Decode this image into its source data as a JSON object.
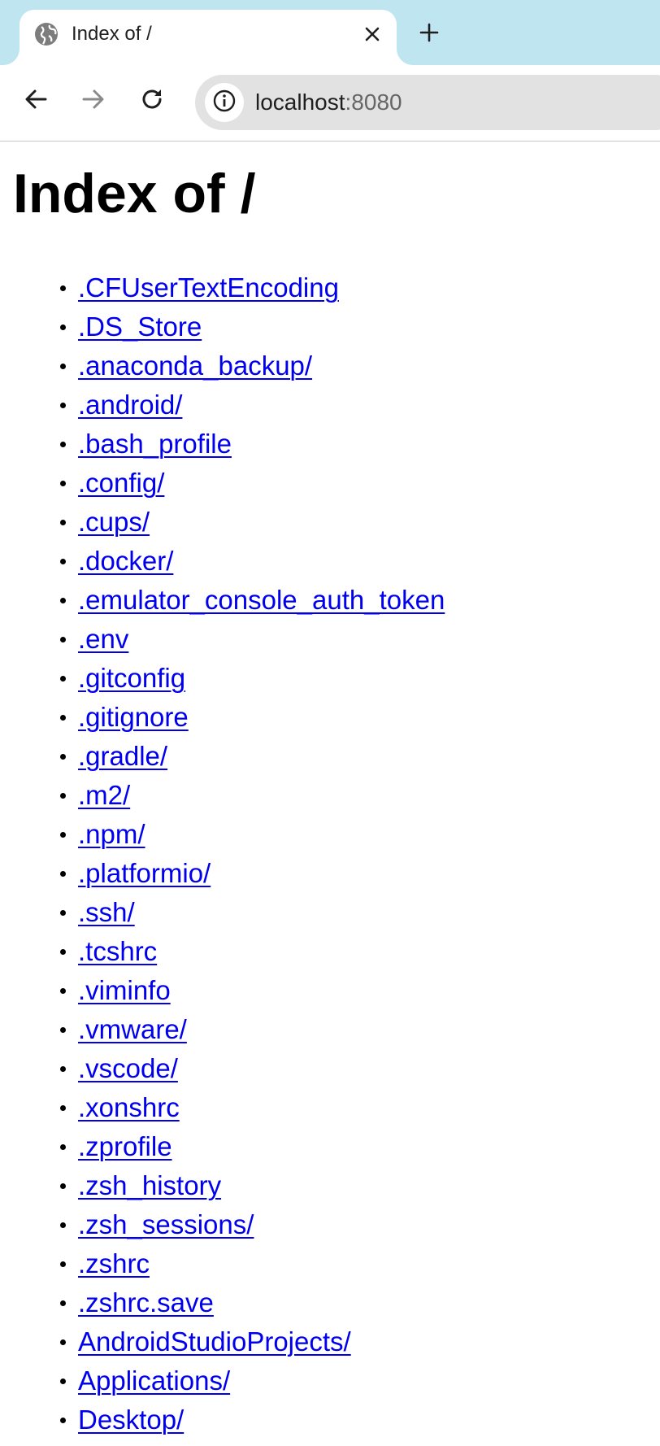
{
  "browser": {
    "tab": {
      "title": "Index of /",
      "favicon": "globe-icon",
      "close_icon": "close-icon"
    },
    "new_tab_icon": "plus-icon",
    "nav": {
      "back_icon": "arrow-left-icon",
      "forward_icon": "arrow-right-icon",
      "reload_icon": "reload-icon"
    },
    "address_bar": {
      "site_info_icon": "info-icon",
      "host": "localhost",
      "port": ":8080"
    },
    "colors": {
      "tabstrip_bg": "#bfe5f1",
      "omnibox_bg": "#e2e2e2",
      "link": "#0000ee"
    }
  },
  "page": {
    "title": "Index of /",
    "entries": [
      ".CFUserTextEncoding",
      ".DS_Store",
      ".anaconda_backup/",
      ".android/",
      ".bash_profile",
      ".config/",
      ".cups/",
      ".docker/",
      ".emulator_console_auth_token",
      ".env",
      ".gitconfig",
      ".gitignore",
      ".gradle/",
      ".m2/",
      ".npm/",
      ".platformio/",
      ".ssh/",
      ".tcshrc",
      ".viminfo",
      ".vmware/",
      ".vscode/",
      ".xonshrc",
      ".zprofile",
      ".zsh_history",
      ".zsh_sessions/",
      ".zshrc",
      ".zshrc.save",
      "AndroidStudioProjects/",
      "Applications/",
      "Desktop/"
    ]
  }
}
